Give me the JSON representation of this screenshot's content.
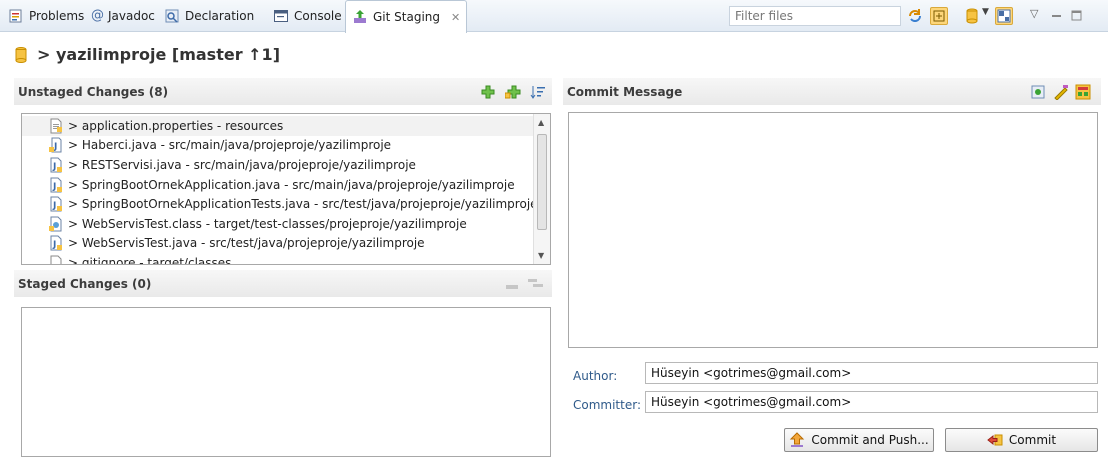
{
  "tabs": [
    {
      "label": "Problems",
      "icon": "problems-icon"
    },
    {
      "label": "Javadoc",
      "icon": "javadoc-icon"
    },
    {
      "label": "Declaration",
      "icon": "declaration-icon"
    },
    {
      "label": "Console",
      "icon": "console-icon"
    },
    {
      "label": "Git Staging",
      "icon": "git-staging-icon",
      "close": "✕"
    }
  ],
  "filter": {
    "placeholder": "Filter files"
  },
  "repo": {
    "title": "> yazilimproje [master ↑1]"
  },
  "unstaged": {
    "title": "Unstaged Changes (8)",
    "files": [
      "> application.properties - resources",
      "> Haberci.java - src/main/java/projeproje/yazilimproje",
      "> RESTServisi.java - src/main/java/projeproje/yazilimproje",
      "> SpringBootOrnekApplication.java - src/main/java/projeproje/yazilimproje",
      "> SpringBootOrnekApplicationTests.java - src/test/java/projeproje/yazilimproje",
      "> WebServisTest.class - target/test-classes/projeproje/yazilimproje",
      "> WebServisTest.java - src/test/java/projeproje/yazilimproje",
      "> gitignore - target/classes"
    ]
  },
  "staged": {
    "title": "Staged Changes (0)"
  },
  "commit": {
    "title": "Commit Message",
    "message": "",
    "author_label": "Author:",
    "author_value": "Hüseyin <gotrimes@gmail.com>",
    "committer_label": "Committer:",
    "committer_value": "Hüseyin <gotrimes@gmail.com>",
    "commit_push_label": "Commit and Push...",
    "commit_label": "Commit"
  },
  "colors": {
    "accent": "#2f5a8a",
    "add": "#3aa335",
    "git": "#f0a30a"
  }
}
